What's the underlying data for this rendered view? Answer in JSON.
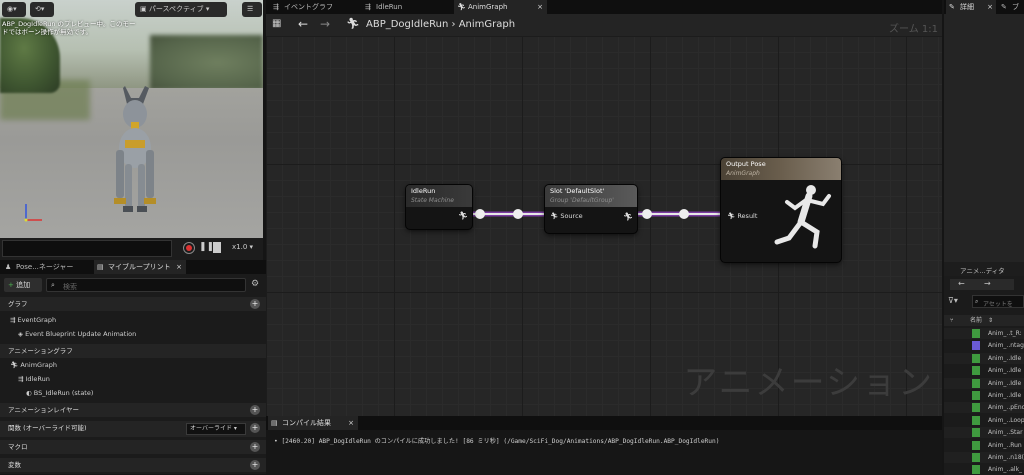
{
  "viewport": {
    "perspective_label": "パースペクティブ",
    "message": "ABP_DogIdleRun のプレビュー中。このモードではボーン操作が無効です。",
    "speed": "x1.0"
  },
  "left_tabs": {
    "pose_manager": "Pose...ネージャー",
    "my_blueprint": "マイブループリント"
  },
  "my_blueprint": {
    "add_label": "追加",
    "search_placeholder": "検索",
    "sections": {
      "graphs": "グラフ",
      "anim_graphs": "アニメーショングラフ",
      "anim_layers": "アニメーションレイヤー",
      "functions": "関数 (オーバーライド可能)",
      "macros": "マクロ",
      "variables": "変数"
    },
    "override_dropdown": "オーバーライド",
    "event_graph": "EventGraph",
    "event_item": "Event Blueprint Update Animation",
    "anim_graph": "AnimGraph",
    "idle_run": "IdleRun",
    "bs_state": "BS_IdleRun (state)"
  },
  "doc_tabs": [
    "イベントグラフ",
    "IdleRun",
    "AnimGraph"
  ],
  "breadcrumb": {
    "root": "ABP_DogIdleRun",
    "sep": "›",
    "current": "AnimGraph"
  },
  "zoom_label": "ズーム 1:1",
  "nodes": {
    "idlerun": {
      "title": "IdleRun",
      "subtitle": "State Machine"
    },
    "slot": {
      "title": "Slot 'DefaultSlot'",
      "subtitle": "Group 'DefaultGroup'",
      "pin": "Source"
    },
    "output": {
      "title": "Output Pose",
      "subtitle": "AnimGraph",
      "pin": "Result"
    }
  },
  "watermark": "アニメーション",
  "compile": {
    "tab": "コンパイル結果",
    "message": "[2460.20] ABP_DogIdleRun のコンパイルに成功しました! [86 ミリ秒] (/Game/SciFi_Dog/Animations/ABP_DogIdleRun.ABP_DogIdleRun)"
  },
  "right": {
    "details_tab": "詳細",
    "blueprint_tab": "ブ",
    "anim_editor_title": "アニメ...ディタ",
    "search_placeholder": "アセットを",
    "name_col": "名前",
    "assets": [
      "Anim_..t_R:",
      "Anim_..ntag",
      "Anim_..Idle",
      "Anim_..Idle",
      "Anim_..Idle",
      "Anim_..Idle",
      "Anim_..pEnc",
      "Anim_..Loop",
      "Anim_..Star",
      "Anim_..Run",
      "Anim_..n18(",
      "Anim_..alk_"
    ]
  },
  "colors": {
    "accent": "#3f9a3f",
    "montage": "#6b5bd6",
    "wire": "#d8d8d8",
    "wire_glow": "#7a3aa0"
  }
}
